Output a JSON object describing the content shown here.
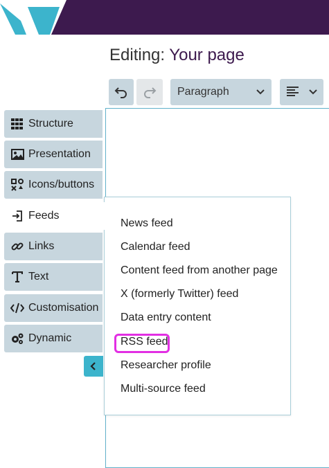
{
  "header": {
    "logo_icon": "w-logo-icon",
    "brand_color": "#3d1a4e",
    "logo_color": "#3cb4cc",
    "title_prefix": "Editing:",
    "title_page": "Your page"
  },
  "toolbar": {
    "undo_icon": "undo-icon",
    "redo_icon": "redo-icon",
    "format_select_value": "Paragraph",
    "align_icon": "align-left-icon"
  },
  "sidebar": {
    "items": [
      {
        "label": "Structure",
        "icon": "grid-icon"
      },
      {
        "label": "Presentation",
        "icon": "image-icon"
      },
      {
        "label": "Icons/buttons",
        "icon": "icons-icon"
      },
      {
        "label": "Feeds",
        "icon": "feed-import-icon",
        "active": true
      },
      {
        "label": "Links",
        "icon": "link-icon"
      },
      {
        "label": "Text",
        "icon": "text-icon"
      },
      {
        "label": "Customisation",
        "icon": "code-icon"
      },
      {
        "label": "Dynamic",
        "icon": "gears-icon"
      }
    ],
    "collapse_icon": "chevron-left-icon"
  },
  "feeds_menu": {
    "items": [
      "News feed",
      "Calendar feed",
      "Content feed from another page",
      "X (formerly Twitter) feed",
      "Data entry content",
      "RSS feed",
      "Researcher profile",
      "Multi-source feed"
    ],
    "highlighted": "RSS feed",
    "highlight_color": "#e22fe3"
  }
}
